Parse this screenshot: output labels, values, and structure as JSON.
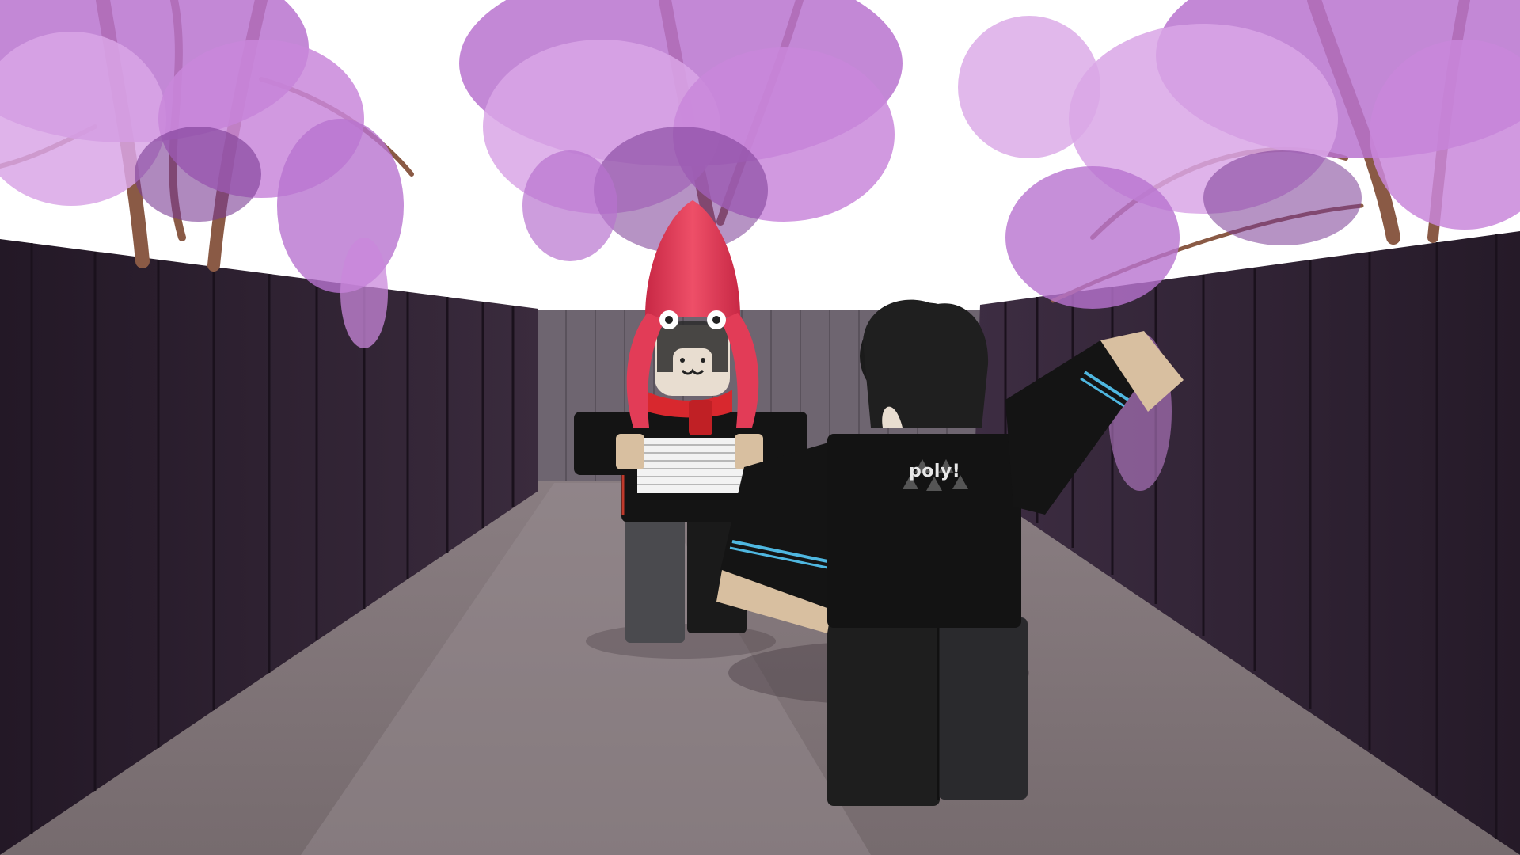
{
  "scene": {
    "title": "",
    "description_hidden": true
  },
  "shirt_logo": {
    "text": "poly!"
  },
  "colors": {
    "sky": "#ffffff",
    "blossom_light": "#d9a6e6",
    "blossom_mid": "#b873cf",
    "blossom_dark": "#7a3a93",
    "trunk": "#8a5a45",
    "fence_side": "#2c1f2e",
    "fence_back": "#6e6570",
    "ground": "#7f7376",
    "squid_hood": "#e23c57",
    "scarf": "#d8282e",
    "outfit_black": "#111111",
    "pants_gray": "#3a3a3d",
    "skin_tan": "#d8bfa0",
    "stripe_blue": "#4fb7e0",
    "logo_text": "#e8e8e8"
  },
  "characters": [
    {
      "name": "squid-hood-avatar",
      "holding": "paper-stack"
    },
    {
      "name": "poly-shirt-avatar",
      "pose": "waving"
    }
  ]
}
